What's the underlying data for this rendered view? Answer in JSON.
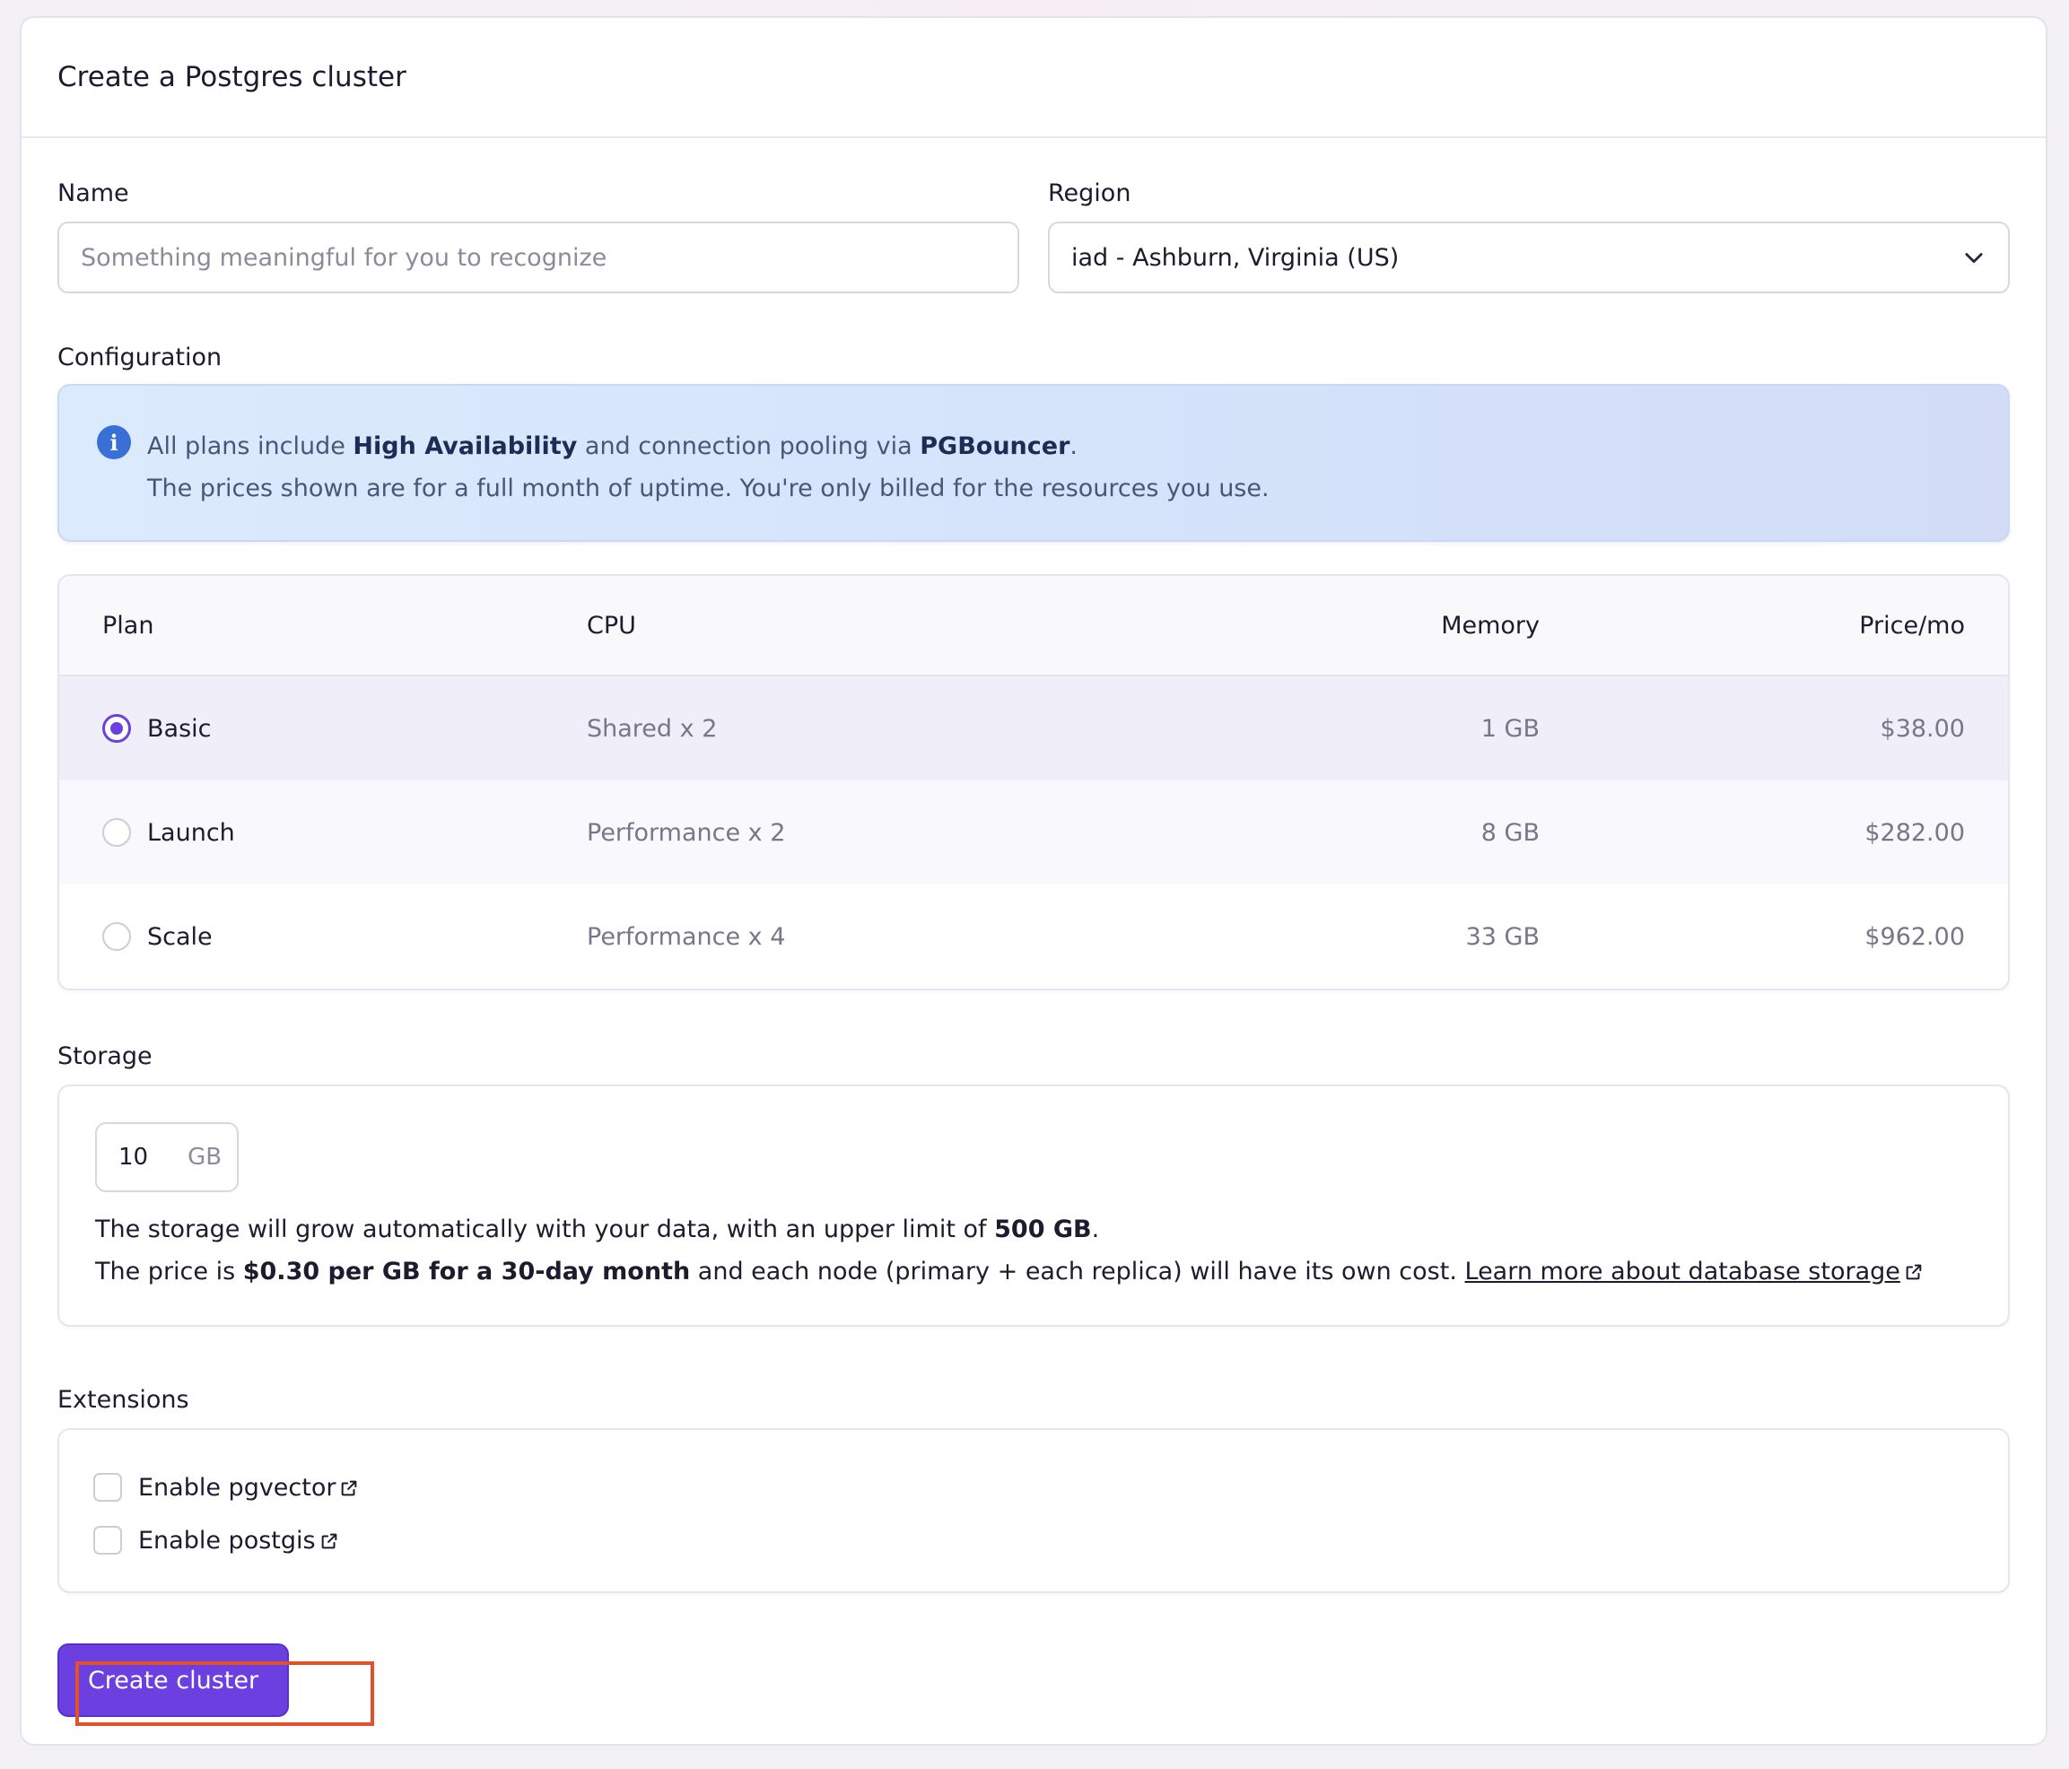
{
  "page": {
    "title": "Create a Postgres cluster"
  },
  "form": {
    "name_label": "Name",
    "name_placeholder": "Something meaningful for you to recognize",
    "region_label": "Region",
    "region_value": "iad - Ashburn, Virginia (US)"
  },
  "configuration": {
    "label": "Configuration",
    "info": {
      "prefix": "All plans include ",
      "ha": "High Availability",
      "middle": " and connection pooling via ",
      "pgb": "PGBouncer",
      "end": ".",
      "line2": "The prices shown are for a full month of uptime. You're only billed for the resources you use."
    }
  },
  "plans": {
    "headers": {
      "plan": "Plan",
      "cpu": "CPU",
      "memory": "Memory",
      "price": "Price/mo"
    },
    "rows": [
      {
        "name": "Basic",
        "cpu": "Shared x 2",
        "memory": "1 GB",
        "price": "$38.00",
        "selected": true
      },
      {
        "name": "Launch",
        "cpu": "Performance x 2",
        "memory": "8 GB",
        "price": "$282.00",
        "selected": false
      },
      {
        "name": "Scale",
        "cpu": "Performance x 4",
        "memory": "33 GB",
        "price": "$962.00",
        "selected": false
      }
    ]
  },
  "storage": {
    "label": "Storage",
    "value": "10",
    "unit": "GB",
    "line1_prefix": "The storage will grow automatically with your data, with an upper limit of ",
    "line1_limit": "500 GB",
    "line1_end": ".",
    "line2_prefix": "The price is ",
    "line2_bold": "$0.30 per GB for a 30-day month",
    "line2_middle": " and each node (primary + each replica) will have its own cost. ",
    "link": "Learn more about database storage"
  },
  "extensions": {
    "label": "Extensions",
    "items": [
      {
        "label": "Enable pgvector",
        "checked": false
      },
      {
        "label": "Enable postgis",
        "checked": false
      }
    ]
  },
  "actions": {
    "create_label": "Create cluster"
  },
  "colors": {
    "accent": "#6b3fe0",
    "highlight": "#e2502c",
    "info_bg": "#dceafd"
  }
}
